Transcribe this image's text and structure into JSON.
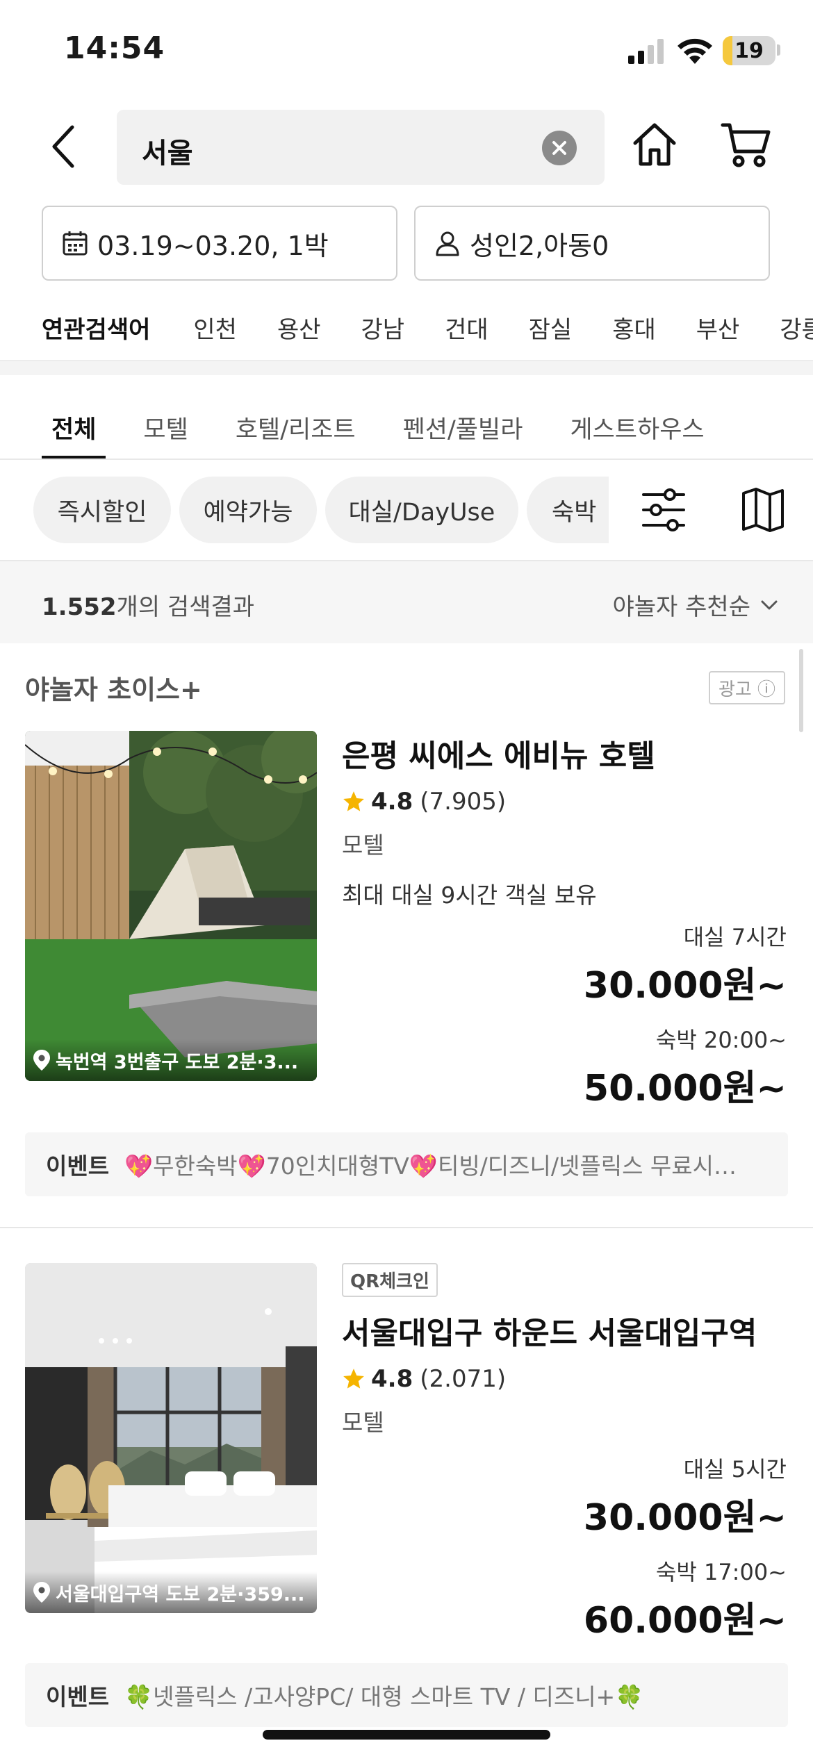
{
  "status_bar": {
    "time": "14:54",
    "battery_level": "19",
    "battery_fraction": 0.19
  },
  "search": {
    "query": "서울"
  },
  "stay": {
    "dates": "03.19~03.20, 1박",
    "guests": "성인2,아동0"
  },
  "related": {
    "label": "연관검색어",
    "items": [
      "인천",
      "용산",
      "강남",
      "건대",
      "잠실",
      "홍대",
      "부산",
      "강릉"
    ]
  },
  "category_tabs": [
    "전체",
    "모텔",
    "호텔/리조트",
    "펜션/풀빌라",
    "게스트하우스"
  ],
  "filters": {
    "chips": [
      "즉시할인",
      "예약가능",
      "대실/DayUse",
      "숙박"
    ]
  },
  "results": {
    "count_value": "1.552",
    "count_suffix": "개의 검색결과",
    "sort": "야놀자 추천순"
  },
  "section": {
    "title": "야놀자 초이스+",
    "ad_label": "광고 ⓘ"
  },
  "listings": [
    {
      "badge": "",
      "name": "은평 씨에스 에비뉴 호텔",
      "rating": "4.8",
      "reviews": "(7.905)",
      "type": "모텔",
      "desc": "최대 대실 9시간 객실 보유",
      "location": "녹번역 3번출구 도보 2분·3...",
      "daystay_label": "대실 7시간",
      "daystay_price": "30.000원~",
      "overnight_label": "숙박 20:00~",
      "overnight_price": "50.000원~",
      "event_label": "이벤트",
      "event_text": "💖무한숙박💖70인치대형TV💖티빙/디즈니/넷플릭스 무료시…"
    },
    {
      "badge": "QR체크인",
      "name": "서울대입구 하운드 서울대입구역",
      "rating": "4.8",
      "reviews": "(2.071)",
      "type": "모텔",
      "desc": "",
      "location": "서울대입구역 도보 2분·359...",
      "daystay_label": "대실 5시간",
      "daystay_price": "30.000원~",
      "overnight_label": "숙박 17:00~",
      "overnight_price": "60.000원~",
      "event_label": "이벤트",
      "event_text": "🍀넷플릭스 /고사양PC/ 대형 스마트 TV / 디즈니+🍀"
    }
  ],
  "colors": {
    "star": "#f5b400",
    "battery": "#f5c83d",
    "chip_bg": "#f1f1f1"
  }
}
